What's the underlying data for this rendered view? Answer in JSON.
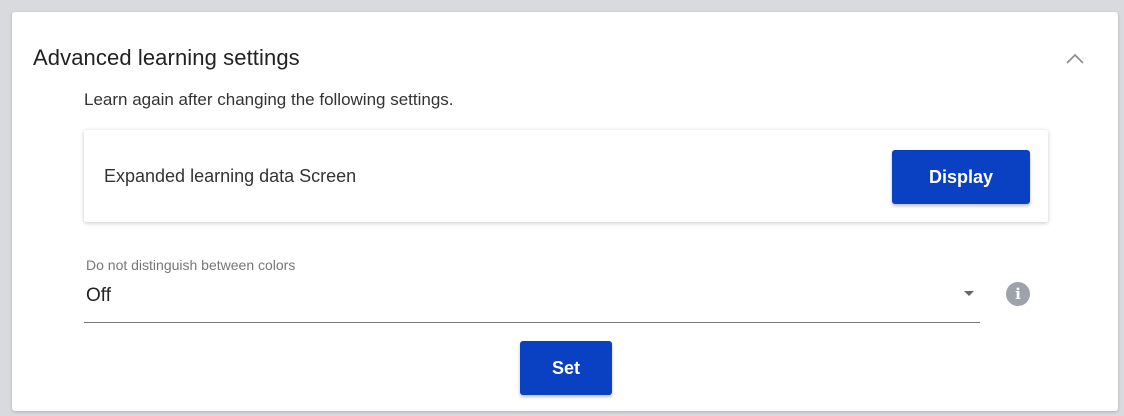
{
  "panel": {
    "title": "Advanced learning settings",
    "collapse_icon": "chevron-up-icon",
    "subtitle": "Learn again after changing the following settings."
  },
  "data_card": {
    "label": "Expanded learning data Screen",
    "button_label": "Display"
  },
  "color_setting": {
    "label": "Do not distinguish between colors",
    "value": "Off",
    "dropdown_icon": "caret-down-icon",
    "info_icon": "info-icon",
    "info_glyph": "i"
  },
  "set_button_label": "Set",
  "colors": {
    "accent": "#0a40c2",
    "background": "#d9dadd",
    "panel": "#ffffff",
    "info_icon": "#9ea3ab"
  }
}
